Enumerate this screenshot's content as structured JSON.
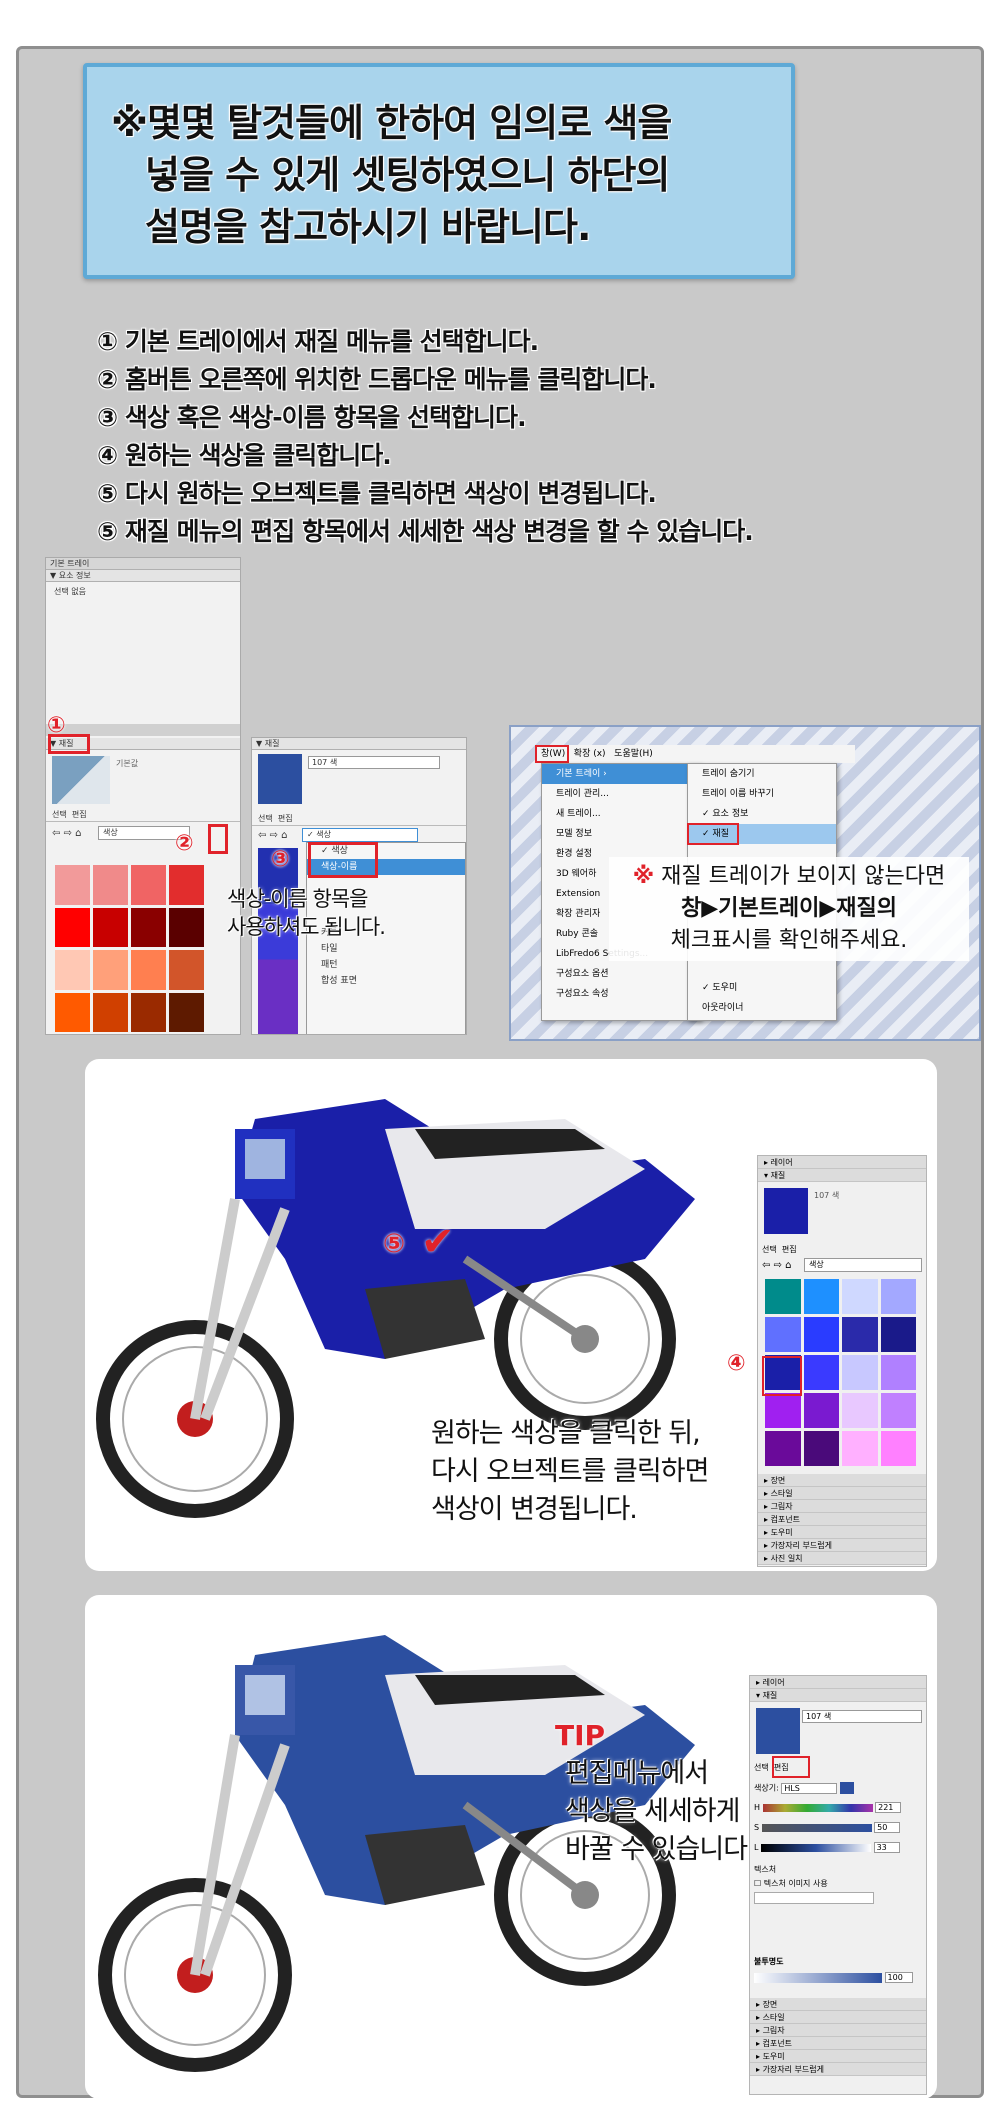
{
  "notice": {
    "line1": "※몇몇 탈것들에 한하여 임의로 색을",
    "line2": "넣을 수 있게 셋팅하였으니 하단의",
    "line3": "설명을 참고하시기 바랍니다."
  },
  "steps": [
    "① 기본 트레이에서 재질 메뉴를 선택합니다.",
    "② 홈버튼 오른쪽에 위치한 드롭다운 메뉴를 클릭합니다.",
    "③ 색상 혹은 색상-이름 항목을 선택합니다.",
    "④ 원하는 색상을 클릭합니다.",
    "⑤ 다시 원하는 오브젝트를 클릭하면 색상이 변경됩니다.",
    "⑤ 재질 메뉴의 편집 항목에서 세세한 색상 변경을 할 수 있습니다."
  ],
  "panel1": {
    "title": "기본 트레이",
    "entity_info": "요소 정보",
    "no_selection": "선택 없음",
    "materials": "재질",
    "default": "기본값",
    "tab_select": "선택",
    "tab_edit": "편집",
    "dropdown": "색상",
    "badge1": "①",
    "badge2": "②"
  },
  "panel2": {
    "materials": "재질",
    "color_name": "107 색",
    "tab_select": "선택",
    "tab_edit": "편집",
    "dropdown": "색상",
    "menu_items": [
      "색상",
      "색상-이름"
    ],
    "extra_items": [
      "커튼",
      "타일",
      "패턴",
      "합성 표면"
    ],
    "badge3": "③",
    "caption1": "색상-이름 항목을",
    "caption2": "사용하셔도 됩니다."
  },
  "panel3": {
    "menubar": [
      "창(W)",
      "확장 (x)",
      "도움말(H)"
    ],
    "window_menu": [
      "기본 트레이",
      "트레이 관리...",
      "새 트레이...",
      "모델 정보",
      "환경 설정",
      "3D 웨어하",
      "Extension",
      "확장 관리자",
      "Ruby 콘솔",
      "LibFredo6 Settings...",
      "구성요소 옵션",
      "구성요소 속성"
    ],
    "sub_menu": [
      "트레이 숨기기",
      "트레이 이름 바꾸기",
      "요소 정보",
      "재질",
      "도우미",
      "아웃라이너"
    ],
    "note_mark": "※",
    "note_line1": "재질 트레이가 보이지 않는다면",
    "note_line2": "창▶기본트레이▶재질의",
    "note_line3": "체크표시를 확인해주세요."
  },
  "card1": {
    "badge5": "⑤",
    "badge4": "④",
    "caption": [
      "원하는 색상을 클릭한 뒤,",
      "다시 오브젝트를 클릭하면",
      "색상이 변경됩니다."
    ],
    "side_top": [
      "레이어",
      "재질"
    ],
    "color_name": "107 색",
    "tab_select": "선택",
    "tab_edit": "편집",
    "dropdown": "색상",
    "side_bottom": [
      "장면",
      "스타일",
      "그림자",
      "컴포넌트",
      "도우미",
      "가장자리 부드럽게",
      "사진 일치"
    ]
  },
  "card2": {
    "tip": "TIP",
    "caption": [
      "편집메뉴에서",
      "색상을 세세하게",
      "바꿀 수 있습니다."
    ],
    "side_top": [
      "레이어",
      "재질"
    ],
    "color_name": "107 색",
    "tab_select": "선택",
    "tab_edit": "편집",
    "picker_label": "색상기:",
    "picker_mode": "HLS",
    "h_label": "H",
    "h_val": "221",
    "s_label": "S",
    "s_val": "50",
    "l_label": "L",
    "l_val": "33",
    "texture": "텍스처",
    "use_texture": "텍스처 이미지 사용",
    "opacity": "불투명도",
    "opacity_val": "100",
    "side_bottom": [
      "장면",
      "스타일",
      "그림자",
      "컴포넌트",
      "도우미",
      "가장자리 부드럽게"
    ]
  },
  "colors": {
    "red_accent": "#e0222a",
    "blue_panel": "#a9d4ec",
    "moto_blue": "#1a1fa8",
    "moto_blue2": "#2c4fa0"
  }
}
